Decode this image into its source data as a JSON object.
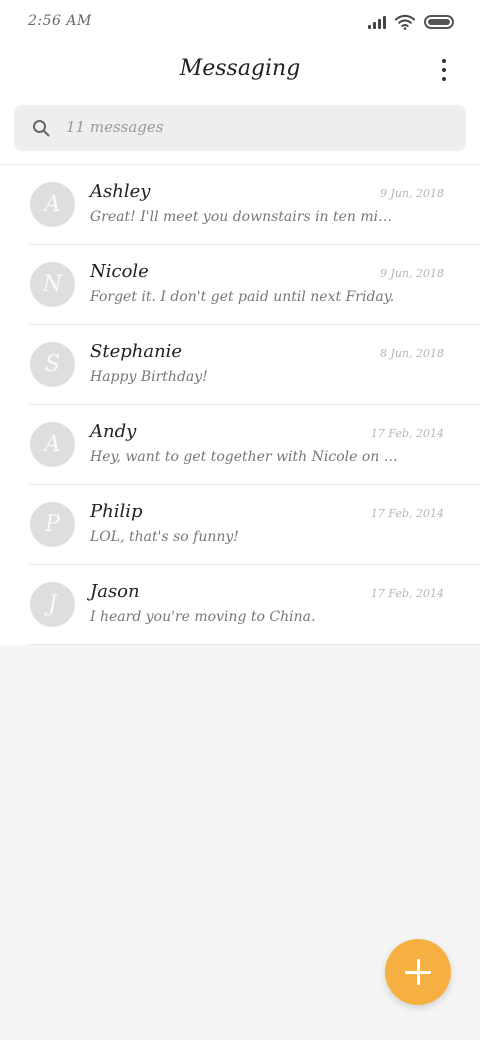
{
  "status_bar": {
    "time": "2:56 AM",
    "icons": [
      "signal-icon",
      "wifi-icon",
      "battery-icon"
    ]
  },
  "header": {
    "title": "Messaging",
    "menu_icon": "more-vertical-icon"
  },
  "search": {
    "placeholder": "11 messages",
    "icon": "search-icon"
  },
  "messages": [
    {
      "initial": "A",
      "name": "Ashley",
      "preview": "Great! I'll meet you downstairs in ten minutes. Don't be late!",
      "date": "9 Jun, 2018"
    },
    {
      "initial": "N",
      "name": "Nicole",
      "preview": "Forget it. I don't get paid until next Friday.",
      "date": "9 Jun, 2018"
    },
    {
      "initial": "S",
      "name": "Stephanie",
      "preview": "Happy Birthday!",
      "date": "8 Jun, 2018"
    },
    {
      "initial": "A",
      "name": "Andy",
      "preview": "Hey, want to get together with Nicole on Friday?",
      "date": "17 Feb, 2014"
    },
    {
      "initial": "P",
      "name": "Philip",
      "preview": "LOL, that's so funny!",
      "date": "17 Feb, 2014"
    },
    {
      "initial": "J",
      "name": "Jason",
      "preview": "I heard you're moving to China.",
      "date": "17 Feb, 2014"
    }
  ],
  "fab": {
    "icon": "plus-icon"
  },
  "colors": {
    "accent": "#f5b041",
    "background": "#f5f5f5",
    "avatar": "#dedede"
  }
}
